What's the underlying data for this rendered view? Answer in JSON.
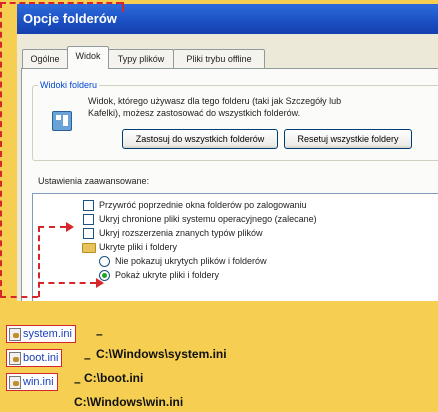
{
  "window": {
    "title": "Opcje folderów"
  },
  "tabs": [
    {
      "label": "Ogólne"
    },
    {
      "label": "Widok"
    },
    {
      "label": "Typy plików"
    },
    {
      "label": "Pliki trybu offline"
    }
  ],
  "folder_view": {
    "label": "Widoki folderu",
    "description_line1": "Widok, którego używasz dla tego folderu (taki jak Szczegóły lub",
    "description_line2": "Kafelki), możesz zastosować do wszystkich folderów.",
    "apply_all_label": "Zastosuj do wszystkich folderów",
    "reset_all_label": "Resetuj wszystkie foldery"
  },
  "advanced": {
    "label": "Ustawienia zaawansowane:",
    "items": [
      {
        "label": "Przywróć poprzednie okna folderów po zalogowaniu",
        "type": "checkbox"
      },
      {
        "label": "Ukryj chronione pliki systemu operacyjnego (zalecane)",
        "type": "checkbox"
      },
      {
        "label": "Ukryj rozszerzenia znanych typów plików",
        "type": "checkbox"
      },
      {
        "label": "Ukryte pliki i foldery",
        "type": "folder"
      },
      {
        "label": "Nie pokazuj ukrytych plików i folderów",
        "type": "radio"
      },
      {
        "label": "Pokaż ukryte pliki i foldery",
        "type": "radio",
        "selected": true
      }
    ]
  },
  "captions": [
    {
      "file": "system.ini",
      "path": "– C:\\Windows\\system.ini"
    },
    {
      "file": "boot.ini",
      "path": "– C:\\boot.ini"
    },
    {
      "file": "win.ini",
      "path": "– C:\\Windows\\win.ini"
    }
  ],
  "colors": {
    "background": "#f6ce52",
    "annotation": "#d7262b",
    "titlebar": "#1a4fc2"
  }
}
